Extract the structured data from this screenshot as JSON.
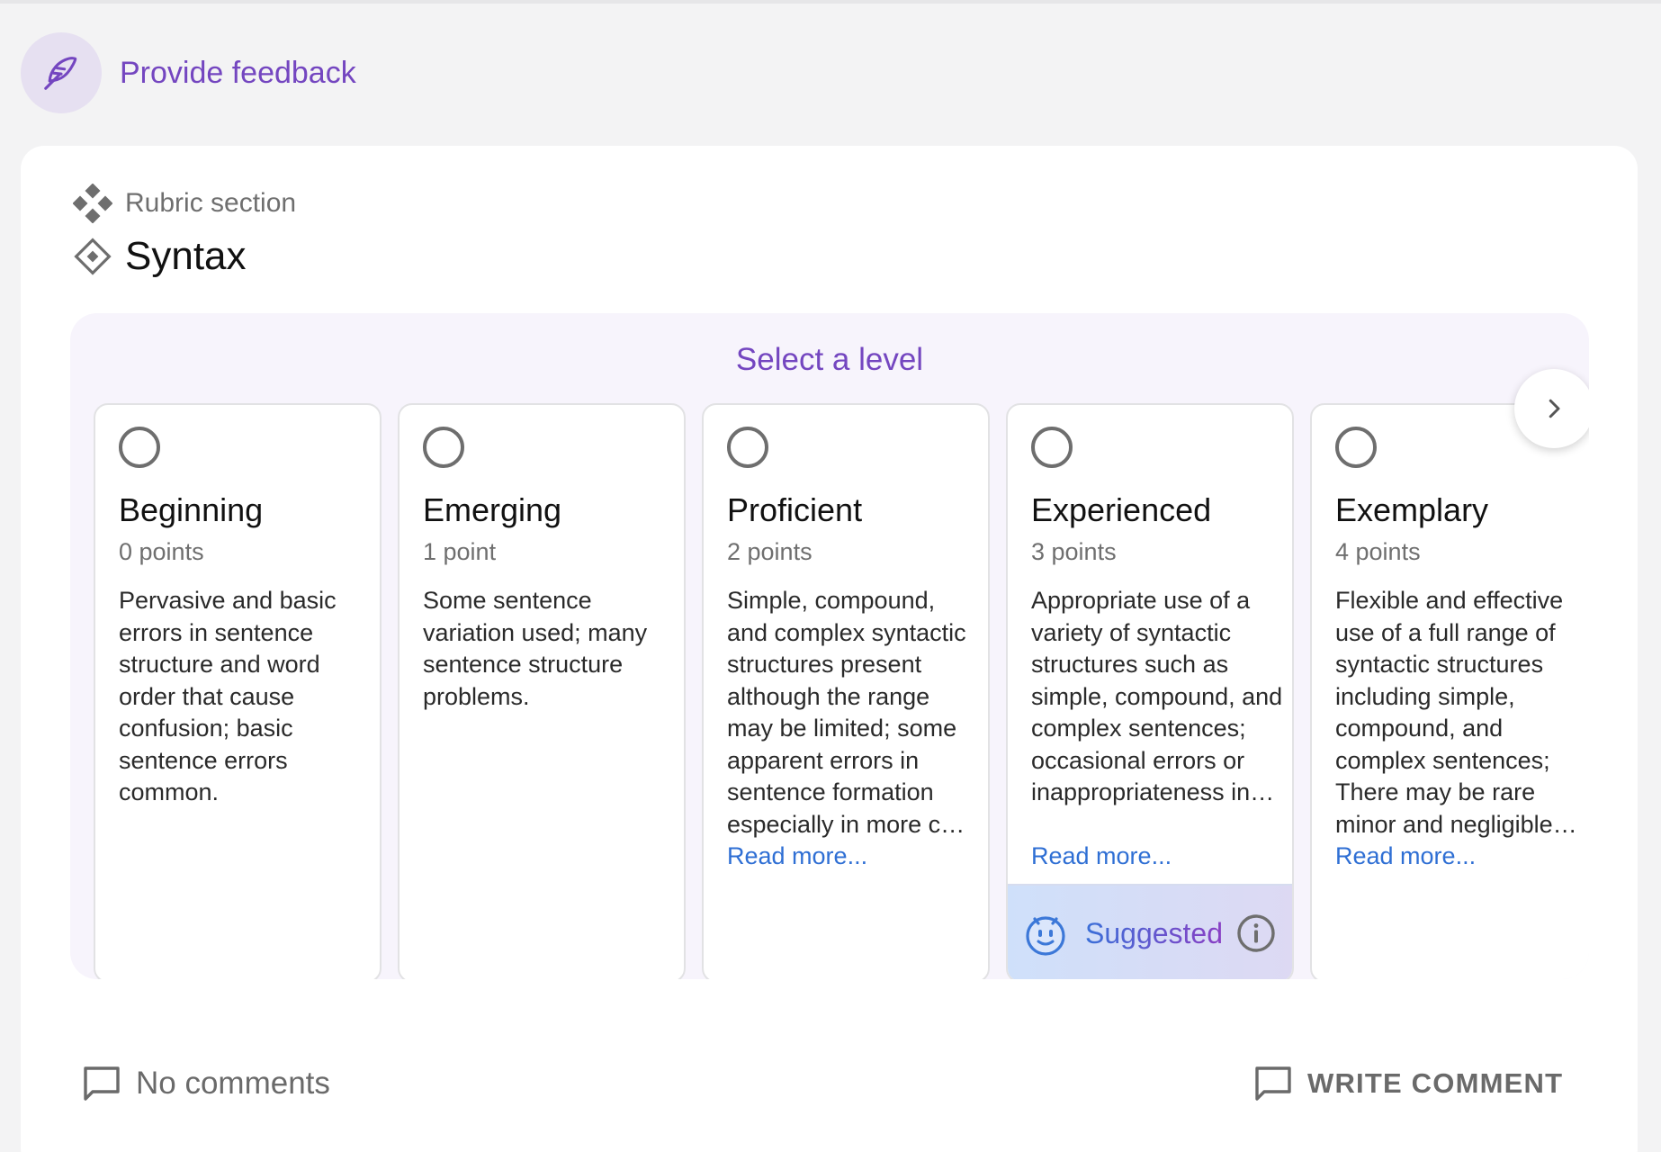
{
  "header": {
    "feedback_label": "Provide feedback",
    "icon": "feather-pen-icon"
  },
  "section": {
    "kicker": "Rubric section",
    "title": "Syntax"
  },
  "levels_panel": {
    "title": "Select a level",
    "next_icon": "chevron-right-icon",
    "levels": [
      {
        "name": "Beginning",
        "points": "0 points",
        "description": "Pervasive and basic errors in sentence structure and word order that cause confusion; basic sentence errors common.",
        "read_more": "",
        "suggested": false
      },
      {
        "name": "Emerging",
        "points": "1 point",
        "description": "Some sentence variation used; many sentence structure problems.",
        "read_more": "",
        "suggested": false
      },
      {
        "name": "Proficient",
        "points": "2 points",
        "description": "Simple, compound, and complex syntactic structures present although the range may be limited; some apparent errors in sentence formation especially in more c…",
        "read_more": "Read more...",
        "suggested": false
      },
      {
        "name": "Experienced",
        "points": "3 points",
        "description": "Appropriate use of a variety of syntactic structures such as simple, compound, and complex sentences; occasional errors or inappropriateness in…",
        "read_more": "Read more...",
        "suggested": true
      },
      {
        "name": "Exemplary",
        "points": "4 points",
        "description": "Flexible and effective use of a full range of syntactic structures including simple, compound, and complex sentences; There may be rare minor and negligible…",
        "read_more": "Read more...",
        "suggested": false
      }
    ],
    "suggested_label": "Suggested"
  },
  "footer": {
    "comments_status": "No comments",
    "write_comment": "WRITE COMMENT"
  },
  "colors": {
    "accent": "#7446c0",
    "link": "#2f6fd4",
    "panel_bg": "#f7f4fc"
  }
}
